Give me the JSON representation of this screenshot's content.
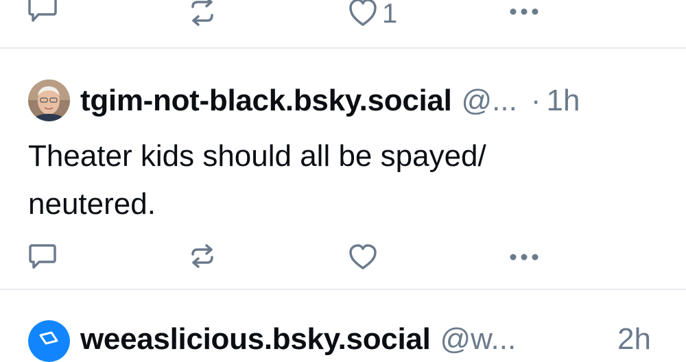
{
  "colors": {
    "icon": "#6b7a8c",
    "divider": "#e6e9ee",
    "text": "#0b0f14",
    "muted": "#6b7a8c",
    "avatar_blue": "#1185fe"
  },
  "post_prev": {
    "like_count": "1",
    "icons": [
      "reply-icon",
      "repost-icon",
      "like-icon",
      "more-icon"
    ]
  },
  "post_main": {
    "handle": "tgim-not-black.bsky.social",
    "at_handle": "@...",
    "separator": "·",
    "time": "1h",
    "text_line1": "Theater kids should all be spayed/",
    "text_line2": "neutered.",
    "icons": [
      "reply-icon",
      "repost-icon",
      "like-icon",
      "more-icon"
    ]
  },
  "post_next": {
    "handle": "weeaslicious.bsky.social",
    "at_handle": "@w...",
    "time": "2h"
  }
}
